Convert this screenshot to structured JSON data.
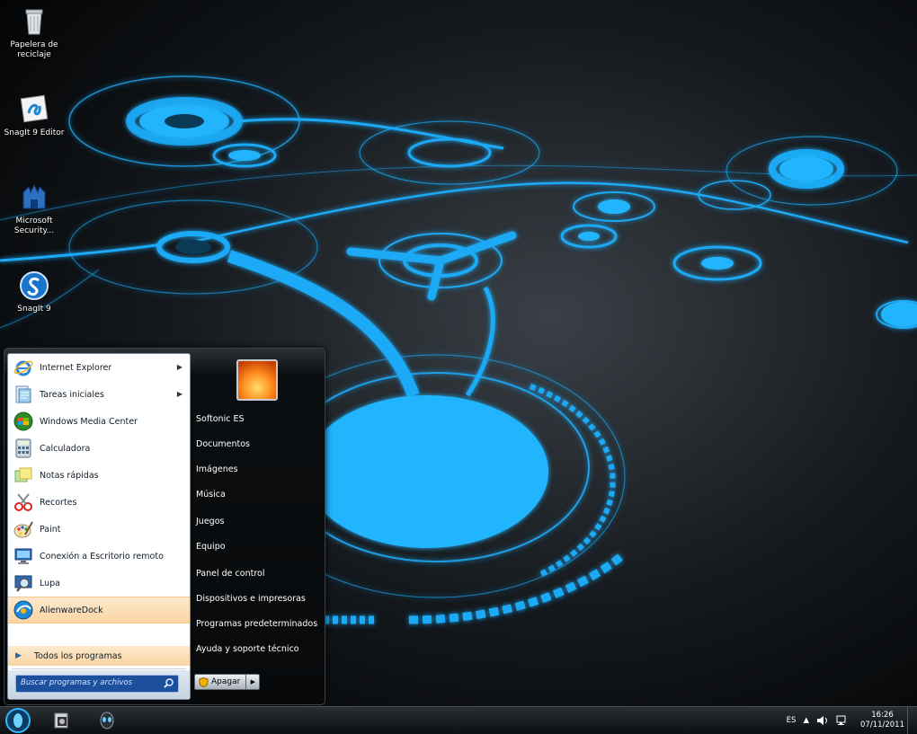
{
  "desktop": {
    "icons": [
      {
        "label": "Papelera de reciclaje",
        "icon": "recycle-bin-icon"
      },
      {
        "label": "SnagIt 9 Editor",
        "icon": "snagit-editor-icon"
      },
      {
        "label": "Microsoft Security...",
        "icon": "security-shield-icon"
      },
      {
        "label": "SnagIt 9",
        "icon": "snagit-icon"
      }
    ]
  },
  "start_menu": {
    "programs": [
      {
        "label": "Internet Explorer",
        "icon": "internet-explorer-icon",
        "submenu": true
      },
      {
        "label": "Tareas iniciales",
        "icon": "getting-started-icon",
        "submenu": true
      },
      {
        "label": "Windows Media Center",
        "icon": "media-center-icon",
        "submenu": false
      },
      {
        "label": "Calculadora",
        "icon": "calculator-icon",
        "submenu": false
      },
      {
        "label": "Notas rápidas",
        "icon": "sticky-notes-icon",
        "submenu": false
      },
      {
        "label": "Recortes",
        "icon": "snipping-tool-icon",
        "submenu": false
      },
      {
        "label": "Paint",
        "icon": "paint-icon",
        "submenu": false
      },
      {
        "label": "Conexión a Escritorio remoto",
        "icon": "remote-desktop-icon",
        "submenu": false
      },
      {
        "label": "Lupa",
        "icon": "magnifier-icon",
        "submenu": false
      },
      {
        "label": "AlienwareDock",
        "icon": "alienware-dock-icon",
        "submenu": false,
        "selected": true
      }
    ],
    "all_programs": "Todos los programas",
    "search_placeholder": "Buscar programas y archivos",
    "right_links": [
      "Softonic ES",
      "Documentos",
      "Imágenes",
      "Música",
      "Juegos",
      "Equipo",
      "Panel de control",
      "Dispositivos e impresoras",
      "Programas predeterminados",
      "Ayuda y soporte técnico"
    ],
    "shutdown_label": "Apagar"
  },
  "taskbar": {
    "language": "ES",
    "time": "16:26",
    "date": "07/11/2011",
    "start_icon": "alienware-orb-icon"
  },
  "colors": {
    "wallpaper_glow": "#22b5ff",
    "menu_highlight": "#fbd5a2",
    "search_box": "#1c4f9c"
  }
}
